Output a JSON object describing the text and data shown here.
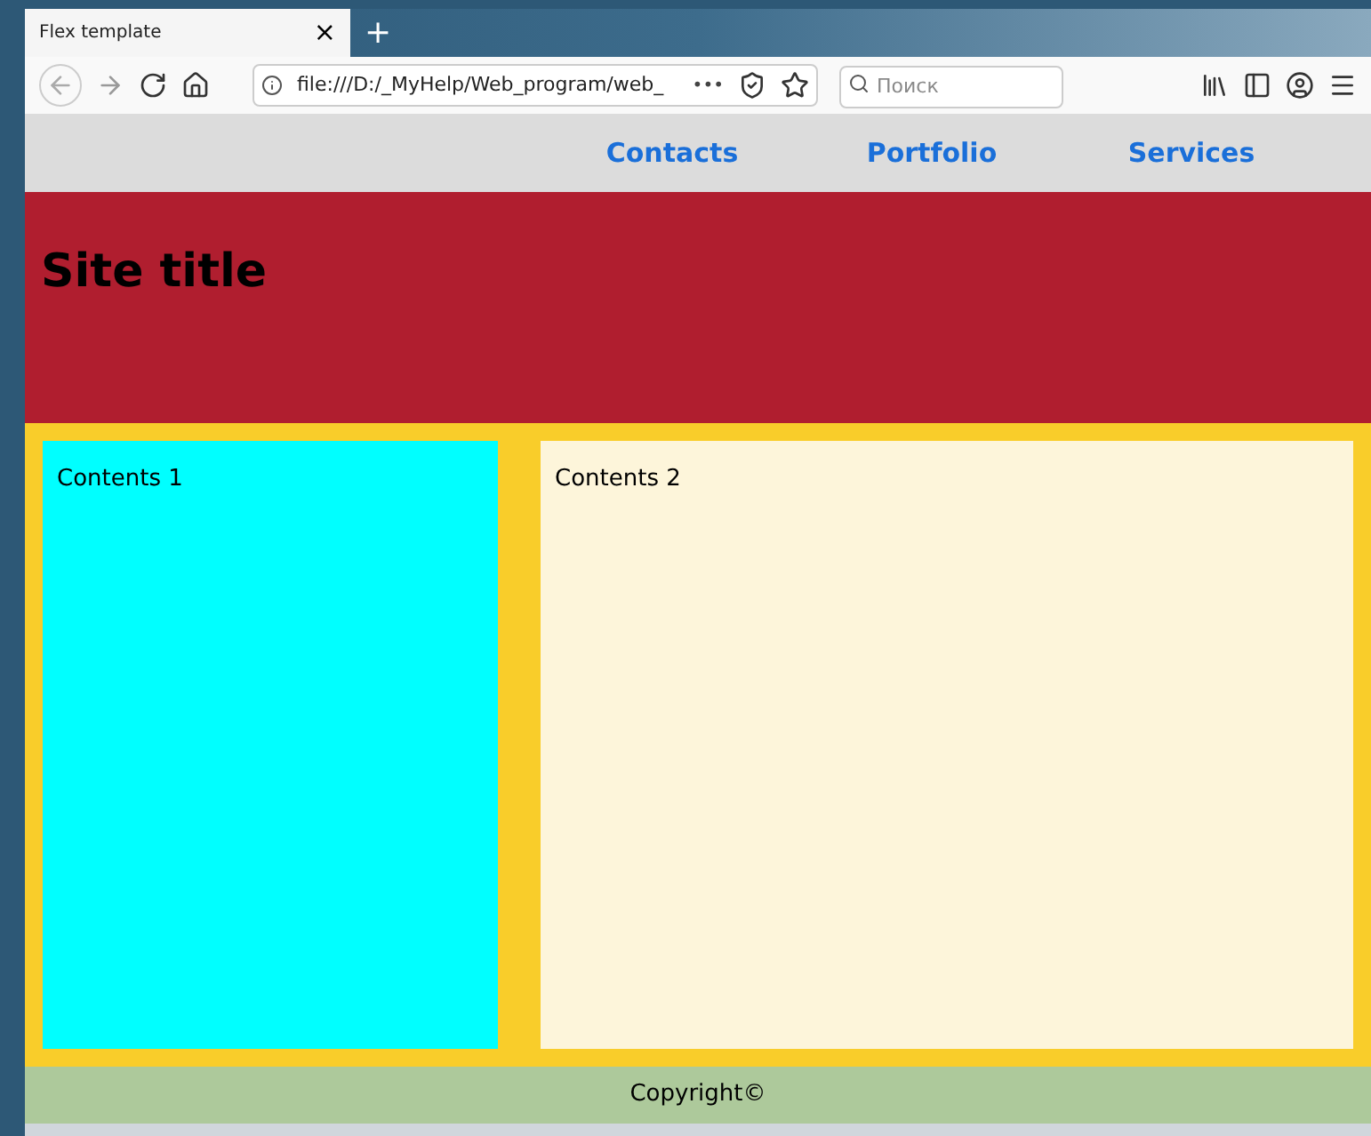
{
  "tab": {
    "title": "Flex template",
    "close": "×",
    "new_tab": "+"
  },
  "address_bar": {
    "url": "file:///D:/_MyHelp/Web_program/web_",
    "more": "•••"
  },
  "search": {
    "placeholder": "Поиск"
  },
  "nav": [
    {
      "label": "Contacts"
    },
    {
      "label": "Portfolio"
    },
    {
      "label": "Services"
    }
  ],
  "header": {
    "title": "Site title"
  },
  "columns": [
    {
      "text": "Contents 1"
    },
    {
      "text": "Contents 2"
    }
  ],
  "footer": {
    "text": "Copyright©"
  }
}
